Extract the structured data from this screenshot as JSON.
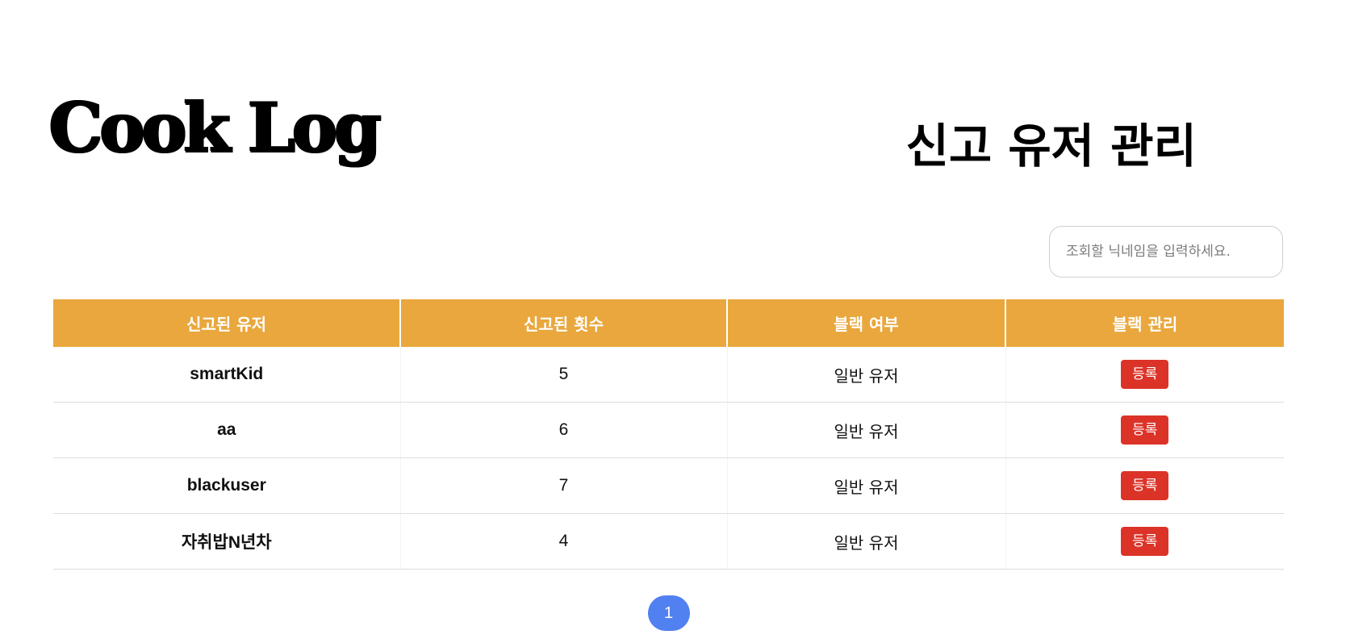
{
  "header": {
    "logo_text": "Cook Log",
    "page_title": "신고 유저 관리"
  },
  "search": {
    "placeholder": "조회할 닉네임을 입력하세요.",
    "value": ""
  },
  "table": {
    "columns": [
      "신고된 유저",
      "신고된 횟수",
      "블랙 여부",
      "블랙 관리"
    ],
    "rows": [
      {
        "nickname": "smartKid",
        "report_count": "5",
        "black_status": "일반 유저",
        "action_label": "등록"
      },
      {
        "nickname": "aa",
        "report_count": "6",
        "black_status": "일반 유저",
        "action_label": "등록"
      },
      {
        "nickname": "blackuser",
        "report_count": "7",
        "black_status": "일반 유저",
        "action_label": "등록"
      },
      {
        "nickname": "자취밥N년차",
        "report_count": "4",
        "black_status": "일반 유저",
        "action_label": "등록"
      }
    ]
  },
  "pagination": {
    "pages": [
      "1"
    ],
    "current": "1"
  },
  "colors": {
    "header_bg": "#e9a73d",
    "register_button": "#dc3328",
    "active_page": "#5180f1"
  }
}
